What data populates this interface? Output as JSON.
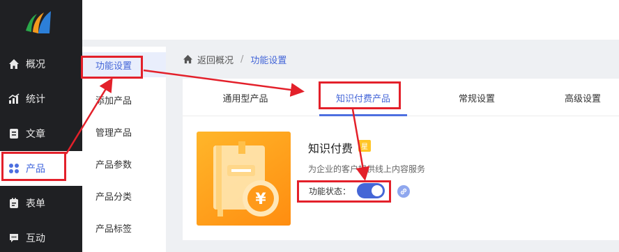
{
  "sidebar": {
    "items": [
      {
        "label": "概况",
        "icon": "home-icon"
      },
      {
        "label": "统计",
        "icon": "stats-icon"
      },
      {
        "label": "文章",
        "icon": "article-icon"
      },
      {
        "label": "产品",
        "icon": "grid-icon"
      },
      {
        "label": "表单",
        "icon": "clipboard-icon"
      },
      {
        "label": "互动",
        "icon": "chat-icon"
      }
    ]
  },
  "submenu": {
    "items": [
      "功能设置",
      "添加产品",
      "管理产品",
      "产品参数",
      "产品分类",
      "产品标签"
    ]
  },
  "breadcrumb": {
    "back": "返回概况",
    "separator": "/",
    "current": "功能设置"
  },
  "tabs": [
    "通用型产品",
    "知识付费产品",
    "常规设置",
    "高级设置"
  ],
  "feature": {
    "title": "知识付费",
    "badge": "星",
    "description": "为企业的客户提供线上内容服务",
    "status_label": "功能状态：",
    "status_on": true
  },
  "colors": {
    "accent": "#4466d8",
    "annotation": "#e3202a",
    "card_orange": "#ff9d1a"
  }
}
